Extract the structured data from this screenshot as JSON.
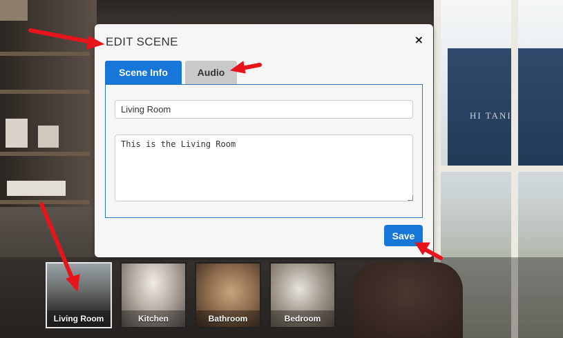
{
  "modal": {
    "title": "EDIT SCENE",
    "close_label": "×",
    "tabs": [
      {
        "label": "Scene Info",
        "active": true
      },
      {
        "label": "Audio",
        "active": false
      }
    ],
    "scene_name": "Living Room",
    "scene_description": "This is the Living Room",
    "save_label": "Save"
  },
  "background": {
    "building_sign": "HI  TANIA"
  },
  "scenes": [
    {
      "label": "Living Room",
      "active": true
    },
    {
      "label": "Kitchen",
      "active": false
    },
    {
      "label": "Bathroom",
      "active": false
    },
    {
      "label": "Bedroom",
      "active": false
    }
  ],
  "colors": {
    "accent": "#1677d9",
    "tab_inactive": "#c9c9c9",
    "annotation_arrow": "#e8141c"
  }
}
